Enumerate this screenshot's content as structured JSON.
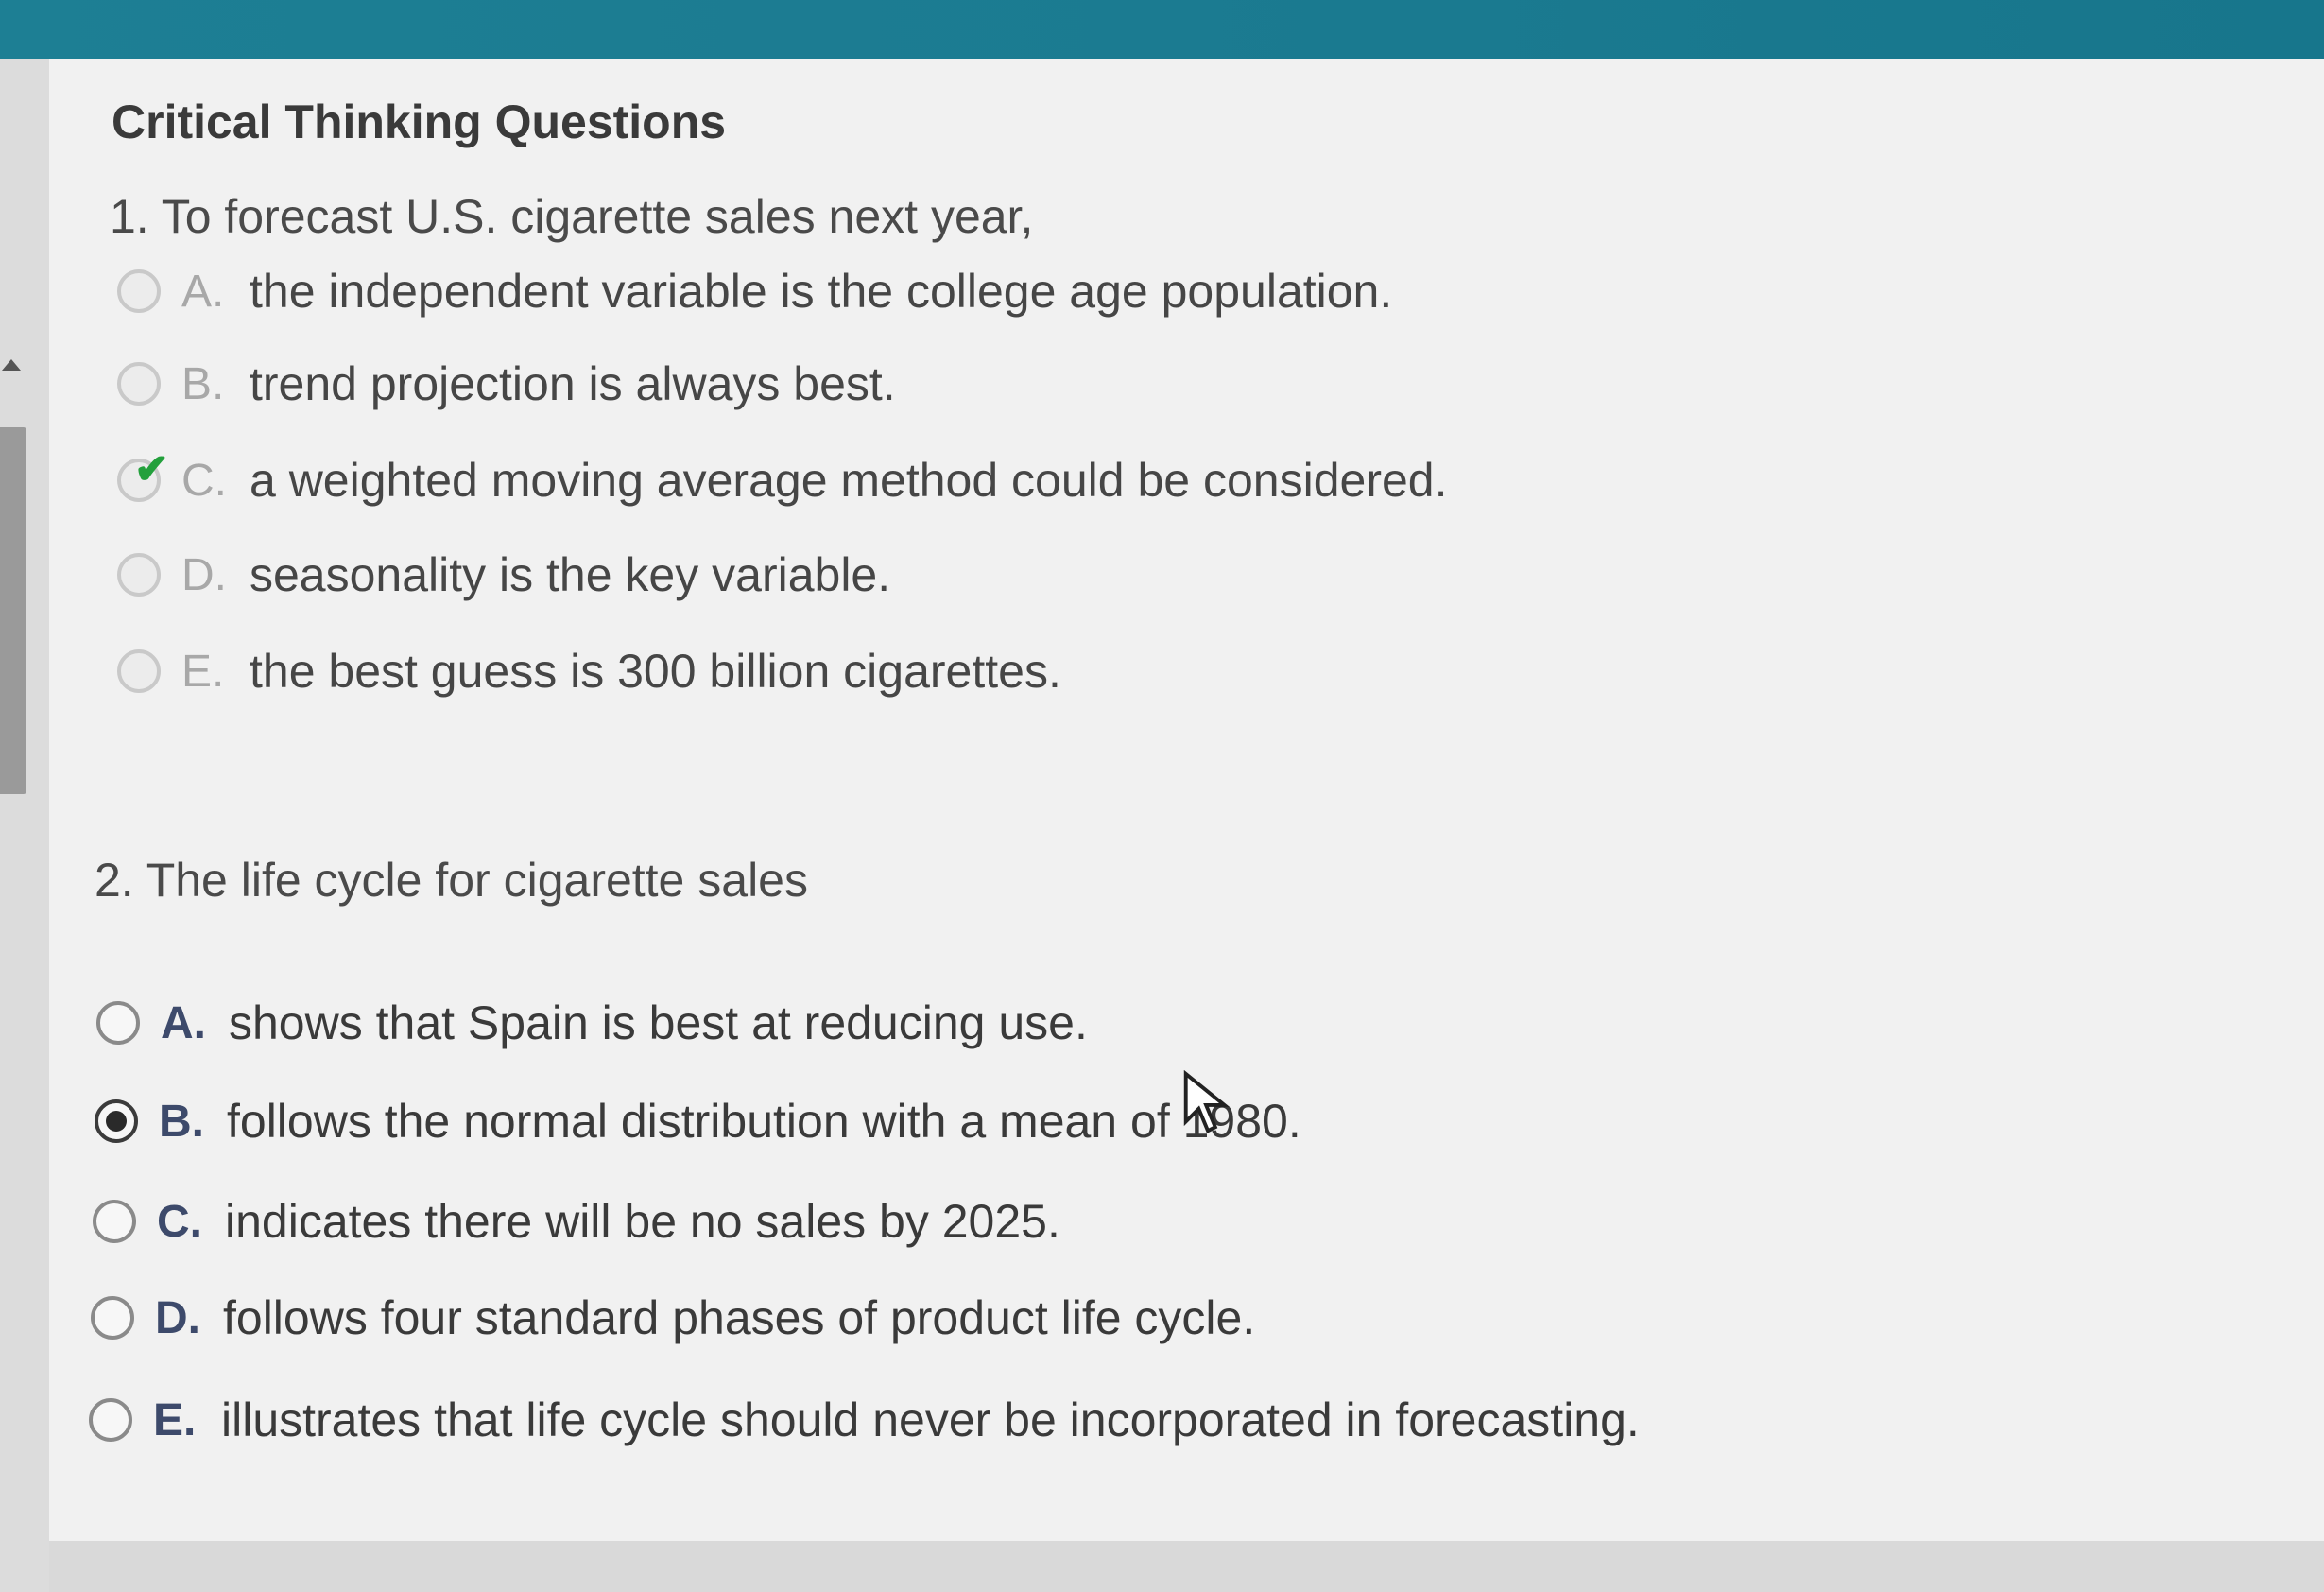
{
  "section_title": "Critical Thinking Questions",
  "questions": [
    {
      "prompt": "1. To forecast U.S. cigarette sales next year,",
      "options": [
        {
          "letter": "A.",
          "text": "the independent variable is the college age population.",
          "state": "unselected"
        },
        {
          "letter": "B.",
          "text": "trend projection is always best.",
          "state": "unselected"
        },
        {
          "letter": "C.",
          "text": "a weighted moving average method could be considered.",
          "state": "correct-check"
        },
        {
          "letter": "D.",
          "text": "seasonality is the key variable.",
          "state": "unselected"
        },
        {
          "letter": "E.",
          "text": "the best guess is 300 billion cigarettes.",
          "state": "unselected"
        }
      ]
    },
    {
      "prompt": "2. The life cycle for cigarette sales",
      "options": [
        {
          "letter": "A.",
          "text": "shows that Spain is best at reducing use.",
          "state": "unselected"
        },
        {
          "letter": "B.",
          "text": "follows the normal distribution with a mean of 1980.",
          "state": "selected"
        },
        {
          "letter": "C.",
          "text": "indicates there will be no sales by 2025.",
          "state": "unselected"
        },
        {
          "letter": "D.",
          "text": "follows four standard phases of product life cycle.",
          "state": "unselected"
        },
        {
          "letter": "E.",
          "text": "illustrates that life cycle should never be incorporated in forecasting.",
          "state": "unselected"
        }
      ]
    }
  ],
  "icons": {
    "check": "checkmark-icon",
    "cursor": "mouse-pointer-icon",
    "scroll_up": "scroll-up-arrow-icon"
  },
  "colors": {
    "header_teal": "#1b7b91",
    "check_green": "#23a03c",
    "letter_navy": "#3d4a6b"
  }
}
